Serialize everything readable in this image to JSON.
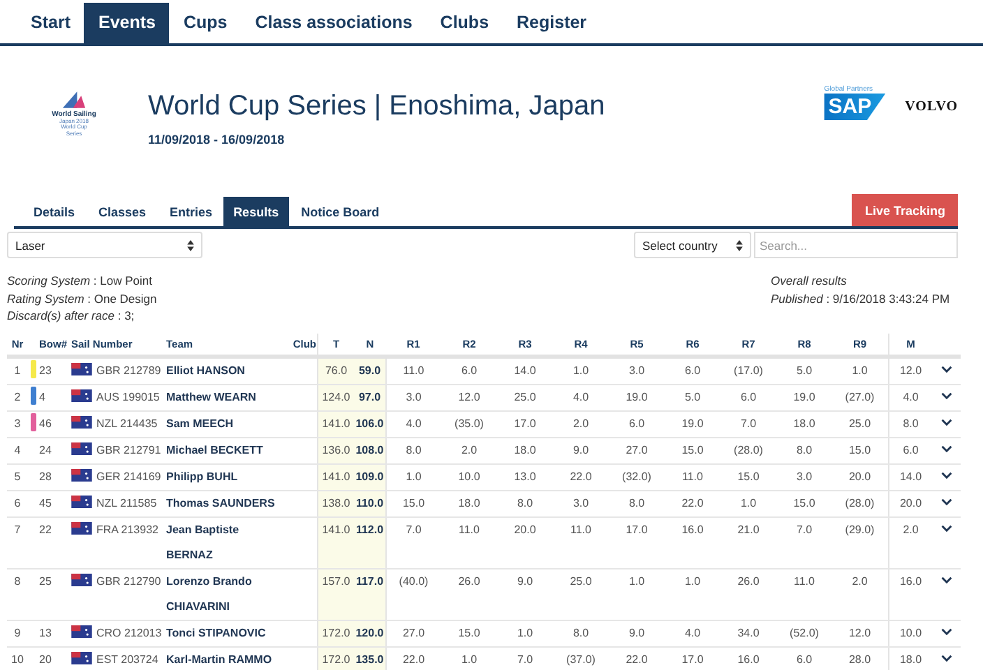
{
  "nav": [
    {
      "label": "Start",
      "selected": false
    },
    {
      "label": "Events",
      "selected": true
    },
    {
      "label": "Cups",
      "selected": false
    },
    {
      "label": "Class associations",
      "selected": false
    },
    {
      "label": "Clubs",
      "selected": false
    },
    {
      "label": "Register",
      "selected": false
    }
  ],
  "logo": {
    "name": "World Sailing",
    "caption": [
      "Japan 2018",
      "World Cup",
      "Series"
    ]
  },
  "event": {
    "title": "World Cup Series | Enoshima, Japan",
    "dates": "11/09/2018 - 16/09/2018"
  },
  "partners": {
    "label": "Global Partners",
    "logos": [
      "SAP",
      "VOLVO"
    ]
  },
  "tabs": [
    {
      "label": "Details",
      "selected": false
    },
    {
      "label": "Classes",
      "selected": false
    },
    {
      "label": "Entries",
      "selected": false
    },
    {
      "label": "Results",
      "selected": true
    },
    {
      "label": "Notice Board",
      "selected": false
    }
  ],
  "live_button": "Live Tracking",
  "filters": {
    "class": "Laser",
    "country": "Select country",
    "search_placeholder": "Search..."
  },
  "info": [
    "*Scoring System* : Low Point",
    "*Rating System* : One Design",
    "*Discard(s) after race* : 3;"
  ],
  "overall": {
    "title": "Overall results",
    "published": "*Published* : 9/16/2018 3:43:24 PM"
  },
  "table": {
    "columns": [
      "Nr",
      "Bow#",
      "Sail Number",
      "Team",
      "Club",
      "T",
      "N",
      "R1",
      "R2",
      "R3",
      "R4",
      "R5",
      "R6",
      "R7",
      "R8",
      "R9",
      "M"
    ],
    "rows": [
      {
        "nr": "1",
        "color": "#f5e94a",
        "bow": "23",
        "sail": "GBR 212789",
        "team": "Elliot HANSON",
        "t": "76.0",
        "n": "59.0",
        "races": [
          "11.0",
          "6.0",
          "14.0",
          "1.0",
          "3.0",
          "6.0",
          "(17.0)",
          "5.0",
          "1.0"
        ],
        "m": "12.0"
      },
      {
        "nr": "2",
        "color": "#3f7fd0",
        "bow": "4",
        "sail": "AUS 199015",
        "team": "Matthew WEARN",
        "t": "124.0",
        "n": "97.0",
        "races": [
          "3.0",
          "12.0",
          "25.0",
          "4.0",
          "19.0",
          "5.0",
          "6.0",
          "19.0",
          "(27.0)"
        ],
        "m": "4.0"
      },
      {
        "nr": "3",
        "color": "#e2609c",
        "bow": "46",
        "sail": "NZL 214435",
        "team": "Sam MEECH",
        "t": "141.0",
        "n": "106.0",
        "races": [
          "4.0",
          "(35.0)",
          "17.0",
          "2.0",
          "6.0",
          "19.0",
          "7.0",
          "18.0",
          "25.0"
        ],
        "m": "8.0"
      },
      {
        "nr": "4",
        "bow": "24",
        "sail": "GBR 212791",
        "team": "Michael BECKETT",
        "t": "136.0",
        "n": "108.0",
        "races": [
          "8.0",
          "2.0",
          "18.0",
          "9.0",
          "27.0",
          "15.0",
          "(28.0)",
          "8.0",
          "15.0"
        ],
        "m": "6.0"
      },
      {
        "nr": "5",
        "bow": "28",
        "sail": "GER 214169",
        "team": "Philipp BUHL",
        "t": "141.0",
        "n": "109.0",
        "races": [
          "1.0",
          "10.0",
          "13.0",
          "22.0",
          "(32.0)",
          "11.0",
          "15.0",
          "3.0",
          "20.0"
        ],
        "m": "14.0"
      },
      {
        "nr": "6",
        "bow": "45",
        "sail": "NZL 211585",
        "team": "Thomas SAUNDERS",
        "t": "138.0",
        "n": "110.0",
        "races": [
          "15.0",
          "18.0",
          "8.0",
          "3.0",
          "8.0",
          "22.0",
          "1.0",
          "15.0",
          "(28.0)"
        ],
        "m": "20.0"
      },
      {
        "nr": "7",
        "bow": "22",
        "sail": "FRA 213932",
        "team": "Jean Baptiste BERNAZ",
        "t": "141.0",
        "n": "112.0",
        "races": [
          "7.0",
          "11.0",
          "20.0",
          "11.0",
          "17.0",
          "16.0",
          "21.0",
          "7.0",
          "(29.0)"
        ],
        "m": "2.0"
      },
      {
        "nr": "8",
        "bow": "25",
        "sail": "GBR 212790",
        "team": "Lorenzo Brando CHIAVARINI",
        "t": "157.0",
        "n": "117.0",
        "races": [
          "(40.0)",
          "26.0",
          "9.0",
          "25.0",
          "1.0",
          "1.0",
          "26.0",
          "11.0",
          "2.0"
        ],
        "m": "16.0"
      },
      {
        "nr": "9",
        "bow": "13",
        "sail": "CRO 212013",
        "team": "Tonci STIPANOVIC",
        "t": "172.0",
        "n": "120.0",
        "races": [
          "27.0",
          "15.0",
          "1.0",
          "8.0",
          "9.0",
          "4.0",
          "34.0",
          "(52.0)",
          "12.0"
        ],
        "m": "10.0"
      },
      {
        "nr": "10",
        "bow": "20",
        "sail": "EST 203724",
        "team": "Karl-Martin RAMMO",
        "t": "172.0",
        "n": "135.0",
        "races": [
          "22.0",
          "1.0",
          "7.0",
          "(37.0)",
          "22.0",
          "17.0",
          "16.0",
          "6.0",
          "28.0"
        ],
        "m": "18.0"
      }
    ]
  }
}
